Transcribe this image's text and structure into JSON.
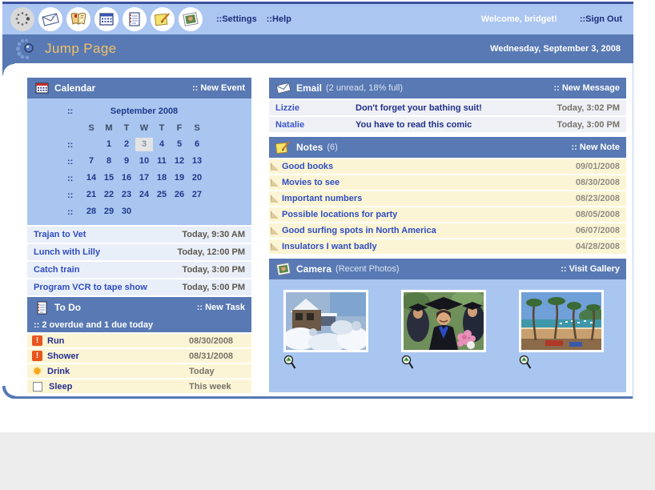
{
  "colors": {
    "toolbar_bg": "#ACC6F2",
    "band_blue": "#5879B3",
    "body_light_blue": "#A9C6F0",
    "cream": "#FCF5D5",
    "event_row": "#E9EFF9",
    "mail_row": "#EFF0F6",
    "link_blue": "#2F4CC0",
    "navy_text": "#1F2F88",
    "title_orange": "#F2C169",
    "overdue_red": "#E8551E",
    "footer_gray": "#EDEDED"
  },
  "toolbar": {
    "icons": [
      "jump-page-icon",
      "email-icon",
      "contacts-icon",
      "calendar-icon",
      "todo-icon",
      "notes-icon",
      "camera-icon"
    ],
    "settings_label": "::Settings",
    "help_label": "::Help",
    "welcome_text": "Welcome, bridget!",
    "signout_label": "::Sign Out"
  },
  "header": {
    "title": "Jump Page",
    "date": "Wednesday, September 3, 2008"
  },
  "calendar": {
    "title": "Calendar",
    "new_event_label": ":: New Event",
    "bullet": "::",
    "month_label": "September 2008",
    "day_headers": [
      "S",
      "M",
      "T",
      "W",
      "T",
      "F",
      "S"
    ],
    "weeks": [
      [
        "",
        "1",
        "2",
        "3",
        "4",
        "5",
        "6"
      ],
      [
        "7",
        "8",
        "9",
        "10",
        "11",
        "12",
        "13"
      ],
      [
        "14",
        "15",
        "16",
        "17",
        "18",
        "19",
        "20"
      ],
      [
        "21",
        "22",
        "23",
        "24",
        "25",
        "26",
        "27"
      ],
      [
        "28",
        "29",
        "30",
        "",
        "",
        "",
        ""
      ]
    ],
    "selected_day": "3",
    "events": [
      {
        "name": "Trajan to Vet",
        "time": "Today, 9:30 AM"
      },
      {
        "name": "Lunch with Lilly",
        "time": "Today, 12:00 PM"
      },
      {
        "name": "Catch train",
        "time": "Today, 3:00 PM"
      },
      {
        "name": "Program VCR to tape show",
        "time": "Today, 5:00 PM"
      }
    ]
  },
  "todo": {
    "title": "To Do",
    "new_task_label": ":: New Task",
    "status": ":: 2 overdue and 1 due today",
    "icon_glyphs": {
      "overdue": "!",
      "today": "✹",
      "none": ""
    },
    "tasks": [
      {
        "name": "Run",
        "due": "08/30/2008",
        "icon": "overdue"
      },
      {
        "name": "Shower",
        "due": "08/31/2008",
        "icon": "overdue"
      },
      {
        "name": "Drink",
        "due": "Today",
        "icon": "today"
      },
      {
        "name": "Sleep",
        "due": "This week",
        "icon": "none"
      }
    ]
  },
  "email": {
    "title": "Email",
    "meta": "(2 unread, 18% full)",
    "new_message_label": ":: New Message",
    "messages": [
      {
        "from": "Lizzie",
        "subject": "Don't forget your bathing suit!",
        "time": "Today, 3:02 PM"
      },
      {
        "from": "Natalie",
        "subject": "You have to read this comic",
        "time": "Today, 3:00 PM"
      }
    ]
  },
  "notes": {
    "title": "Notes",
    "meta": "(6)",
    "new_note_label": ":: New Note",
    "items": [
      {
        "title": "Good books",
        "date": "09/01/2008"
      },
      {
        "title": "Movies to see",
        "date": "08/30/2008"
      },
      {
        "title": "Important numbers",
        "date": "08/23/2008"
      },
      {
        "title": "Possible locations for party",
        "date": "08/05/2008"
      },
      {
        "title": "Good surfing spots in North America",
        "date": "06/07/2008"
      },
      {
        "title": "Insulators I want badly",
        "date": "04/28/2008"
      }
    ]
  },
  "camera": {
    "title": "Camera",
    "meta": "(Recent Photos)",
    "visit_gallery_label": ":: Visit Gallery",
    "photos": [
      {
        "name": "snowy-house-photo"
      },
      {
        "name": "graduation-photo"
      },
      {
        "name": "beach-harbor-photo"
      }
    ]
  }
}
